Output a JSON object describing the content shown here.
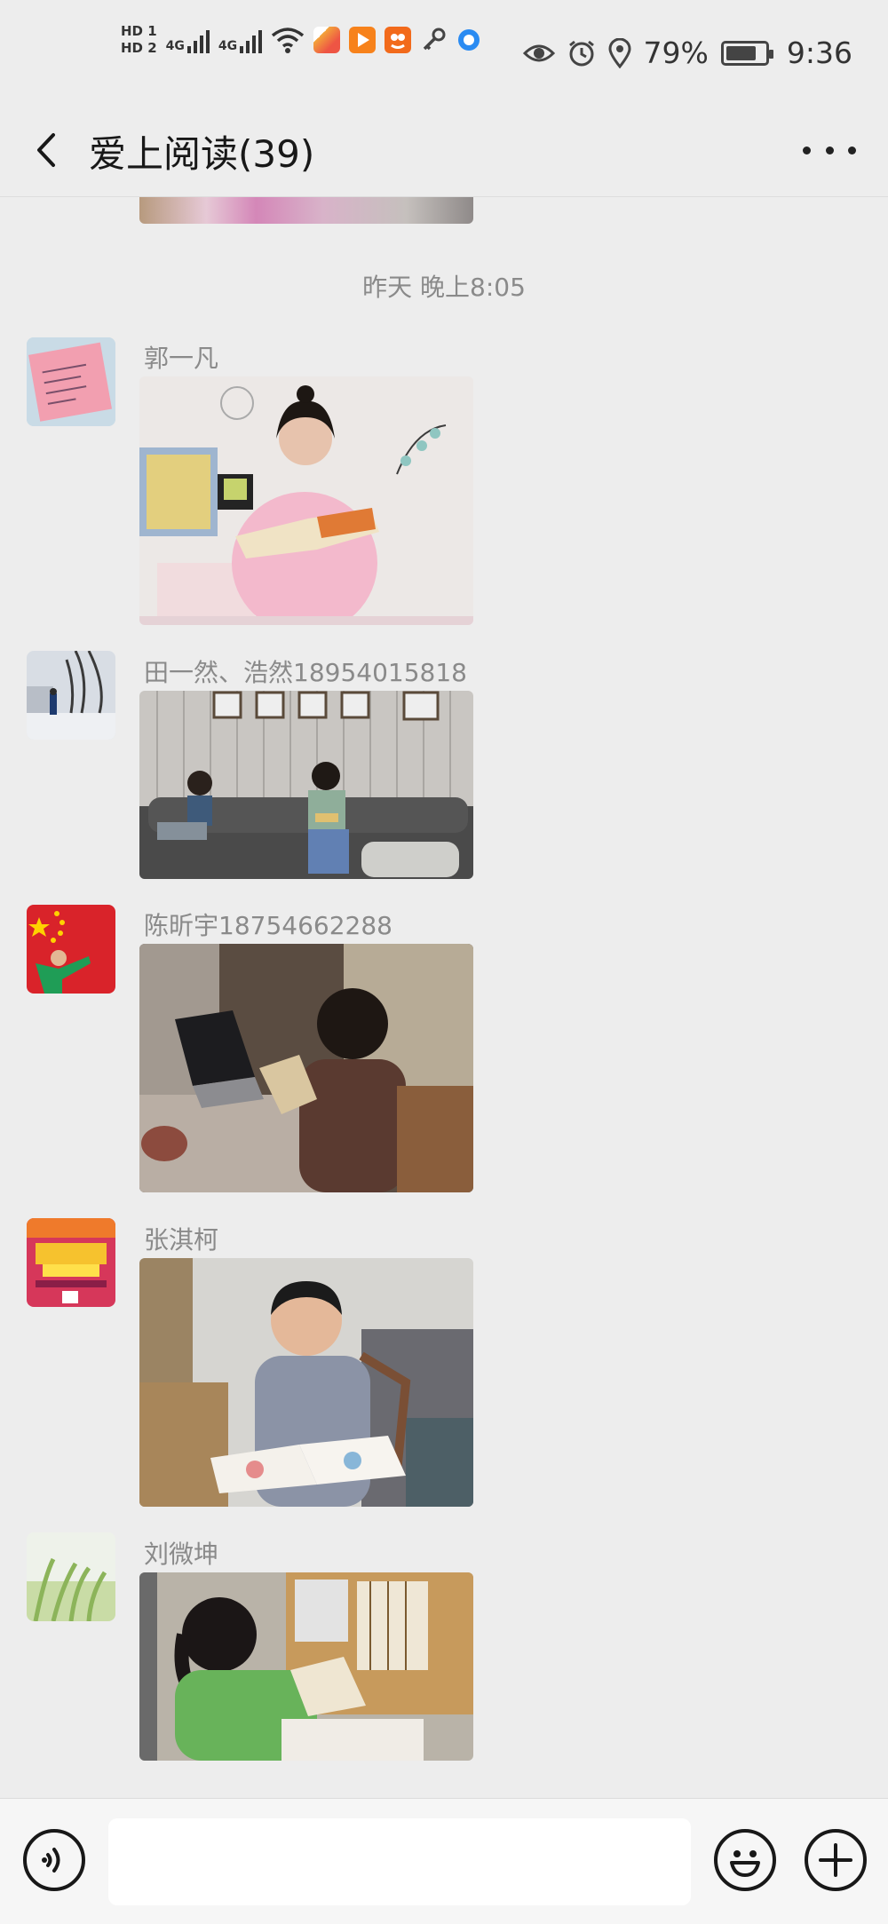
{
  "status_bar": {
    "hd1": "HD 1",
    "hd2": "HD 2",
    "net1": "4G",
    "net2": "4G",
    "battery_pct": "79%",
    "time": "9:36",
    "icons": [
      "eye-icon",
      "alarm-icon",
      "location-icon",
      "battery-icon"
    ]
  },
  "header": {
    "title": "爱上阅读(39)",
    "back_icon": "back-arrow-icon",
    "more_icon": "more-icon"
  },
  "chat": {
    "timestamp": "昨天 晚上8:05",
    "messages": [
      {
        "sender": "郭一凡",
        "type": "image"
      },
      {
        "sender": "田一然、浩然18954015818",
        "type": "image"
      },
      {
        "sender": "陈昕宇18754662288",
        "type": "image"
      },
      {
        "sender": "张淇柯",
        "type": "image"
      },
      {
        "sender": "刘微坤",
        "type": "image"
      }
    ]
  },
  "input_bar": {
    "voice_icon": "voice-icon",
    "emoji_icon": "emoji-icon",
    "plus_icon": "plus-icon",
    "placeholder": ""
  },
  "colors": {
    "background": "#ededed",
    "input_bg": "#ffffff",
    "bar_bg": "#f6f6f6",
    "meta_text": "#8a8a8a"
  }
}
